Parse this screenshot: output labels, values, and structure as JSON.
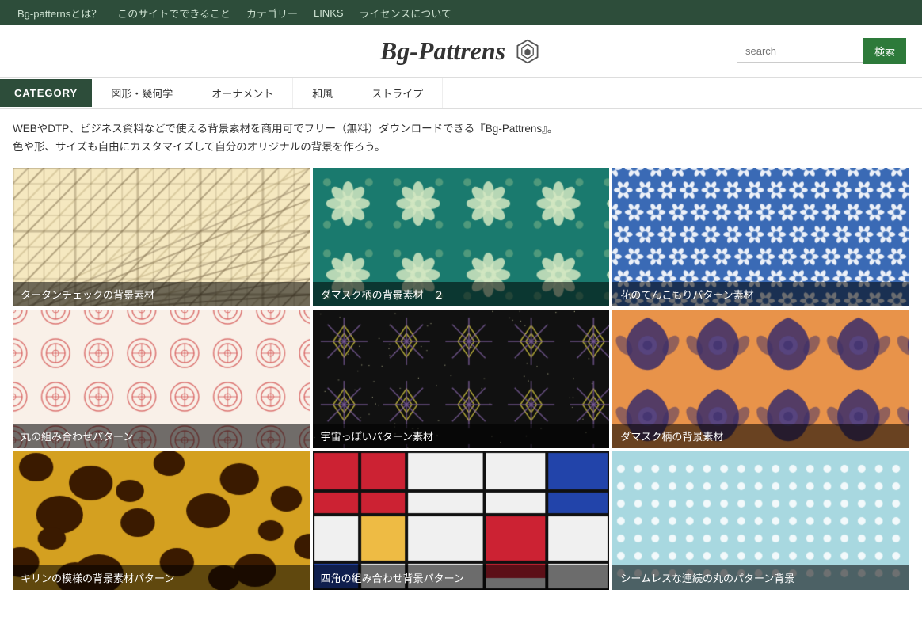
{
  "nav": {
    "items": [
      {
        "label": "Bg-patternsとは？"
      },
      {
        "label": "このサイトでできること"
      },
      {
        "label": "カテゴリー"
      },
      {
        "label": "LINKS"
      },
      {
        "label": "ライセンスについて"
      }
    ]
  },
  "header": {
    "logo": "Bg-Pattrens",
    "search_placeholder": "search",
    "search_button": "検索"
  },
  "category": {
    "label": "CATEGORY",
    "tabs": [
      {
        "label": "図形・幾何学"
      },
      {
        "label": "オーナメント"
      },
      {
        "label": "和風"
      },
      {
        "label": "ストライプ"
      }
    ]
  },
  "description": {
    "line1": "WEBやDTP、ビジネス資料などで使える背景素材を商用可でフリー（無料）ダウンロードできる『Bg-Pattrens』。",
    "line2": "色や形、サイズも自由にカスタマイズして自分のオリジナルの背景を作ろう。"
  },
  "grid": {
    "items": [
      {
        "label": "タータンチェックの背景素材",
        "pattern": "tartan"
      },
      {
        "label": "ダマスク柄の背景素材　２",
        "pattern": "damask-teal"
      },
      {
        "label": "花のてんこもりパターン素材",
        "pattern": "flowers-blue"
      },
      {
        "label": "丸の組み合わせパターン",
        "pattern": "circles-red"
      },
      {
        "label": "宇宙っぽいパターン素材",
        "pattern": "space"
      },
      {
        "label": "ダマスク柄の背景素材",
        "pattern": "damask-orange"
      },
      {
        "label": "キリンの模様の背景素材パターン",
        "pattern": "giraffe"
      },
      {
        "label": "四角の組み合わせ背景パターン",
        "pattern": "mondrian"
      },
      {
        "label": "シームレスな連続の丸のパターン背景",
        "pattern": "dots-blue"
      }
    ]
  },
  "colors": {
    "nav_bg": "#2d4d3a",
    "category_active": "#2d4d3a",
    "search_btn": "#2d7a3a"
  }
}
